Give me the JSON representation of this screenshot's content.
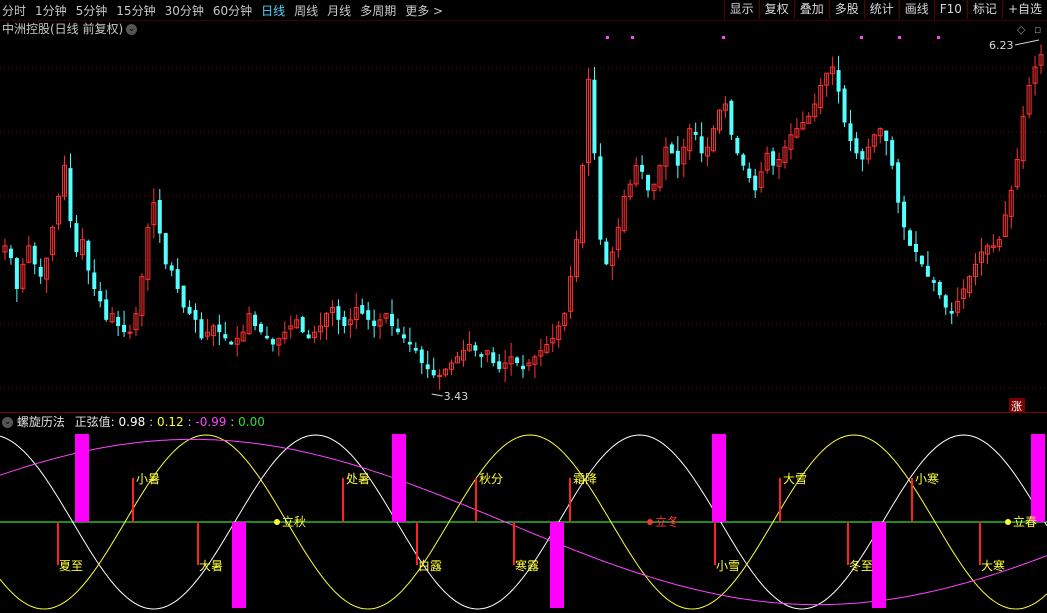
{
  "toolbar": {
    "periods": [
      "分时",
      "1分钟",
      "5分钟",
      "15分钟",
      "30分钟",
      "60分钟",
      "日线",
      "周线",
      "月线",
      "多周期",
      "更多 >"
    ],
    "active_period": "日线",
    "buttons": [
      "显示",
      "复权",
      "叠加",
      "多股",
      "统计",
      "画线",
      "F10",
      "标记",
      "+自选"
    ]
  },
  "stock": {
    "title": "中洲控股(日线 前复权)",
    "high_label": "6.23",
    "low_label": "3.43",
    "zhang_badge": "涨"
  },
  "indicator": {
    "name": "螺旋历法",
    "value_label": "正弦值:",
    "v1": "0.98",
    "sep": ":",
    "v2": "0.12",
    "v3": "-0.99",
    "v4": "0.00"
  },
  "solar_terms": [
    {
      "name": "夏至",
      "color": "yellow"
    },
    {
      "name": "小暑",
      "color": "yellow"
    },
    {
      "name": "大暑",
      "color": "yellow"
    },
    {
      "name": "立秋",
      "color": "yellow"
    },
    {
      "name": "处暑",
      "color": "yellow"
    },
    {
      "name": "白露",
      "color": "yellow"
    },
    {
      "name": "秋分",
      "color": "yellow"
    },
    {
      "name": "寒露",
      "color": "yellow"
    },
    {
      "name": "霜降",
      "color": "yellow"
    },
    {
      "name": "立冬",
      "color": "red"
    },
    {
      "name": "小雪",
      "color": "yellow"
    },
    {
      "name": "大雪",
      "color": "yellow"
    },
    {
      "name": "冬至",
      "color": "yellow"
    },
    {
      "name": "小寒",
      "color": "yellow"
    },
    {
      "name": "大寒",
      "color": "yellow"
    },
    {
      "name": "立春",
      "color": "yellow"
    }
  ],
  "chart_data": [
    {
      "type": "candlestick",
      "title": "中洲控股(日线 前复权)",
      "up_color": "#ff3232",
      "down_color": "#54ffff",
      "ylim": [
        3.3,
        6.3
      ],
      "annotations": [
        {
          "label": "6.23",
          "type": "high"
        },
        {
          "label": "3.43",
          "type": "low"
        }
      ],
      "closes": [
        4.55,
        4.45,
        4.2,
        4.4,
        4.55,
        4.4,
        4.3,
        4.45,
        4.7,
        4.95,
        5.2,
        4.75,
        4.5,
        4.6,
        4.35,
        4.2,
        4.1,
        3.95,
        4.0,
        3.9,
        3.85,
        3.85,
        4.0,
        4.3,
        4.7,
        4.9,
        4.65,
        4.4,
        4.35,
        4.2,
        4.05,
        4.0,
        3.95,
        3.8,
        3.85,
        3.9,
        3.85,
        3.8,
        3.75,
        3.8,
        3.85,
        4.0,
        3.9,
        3.85,
        3.8,
        3.75,
        3.8,
        3.85,
        3.9,
        3.95,
        3.85,
        3.8,
        3.85,
        3.9,
        4.0,
        4.05,
        3.95,
        3.9,
        3.95,
        4.05,
        4.0,
        3.95,
        3.9,
        3.95,
        4.0,
        3.9,
        3.85,
        3.8,
        3.75,
        3.7,
        3.6,
        3.55,
        3.5,
        3.5,
        3.55,
        3.6,
        3.65,
        3.7,
        3.75,
        3.7,
        3.65,
        3.7,
        3.6,
        3.55,
        3.6,
        3.65,
        3.6,
        3.55,
        3.6,
        3.65,
        3.7,
        3.75,
        3.8,
        3.9,
        4.0,
        4.3,
        4.6,
        5.2,
        5.9,
        5.3,
        4.6,
        4.4,
        4.5,
        4.7,
        4.95,
        5.05,
        5.2,
        5.15,
        5.0,
        5.05,
        5.2,
        5.35,
        5.3,
        5.2,
        5.35,
        5.5,
        5.45,
        5.3,
        5.35,
        5.5,
        5.65,
        5.7,
        5.45,
        5.3,
        5.2,
        5.1,
        5.0,
        5.15,
        5.3,
        5.2,
        5.25,
        5.35,
        5.45,
        5.5,
        5.55,
        5.6,
        5.7,
        5.85,
        5.95,
        6.0,
        5.8,
        5.55,
        5.4,
        5.3,
        5.25,
        5.35,
        5.45,
        5.5,
        5.4,
        5.2,
        4.9,
        4.7,
        4.55,
        4.5,
        4.4,
        4.3,
        4.25,
        4.15,
        4.05,
        4.0,
        4.1,
        4.2,
        4.3,
        4.4,
        4.5,
        4.55,
        4.55,
        4.6,
        4.8,
        5.0,
        5.25,
        5.6,
        5.85,
        6.0,
        6.1
      ]
    },
    {
      "type": "line",
      "title": "螺旋历法",
      "ylim": [
        -1,
        1
      ],
      "series": [
        {
          "name": "正弦值",
          "color": "#ffffff",
          "values_label": "0.98"
        },
        {
          "name": "",
          "color": "#ffff3b",
          "values_label": "0.12"
        },
        {
          "name": "",
          "color": "#ff44ff",
          "values_label": "-0.99"
        },
        {
          "name": "",
          "color": "#33dd33",
          "values_label": "0.00"
        }
      ]
    }
  ]
}
